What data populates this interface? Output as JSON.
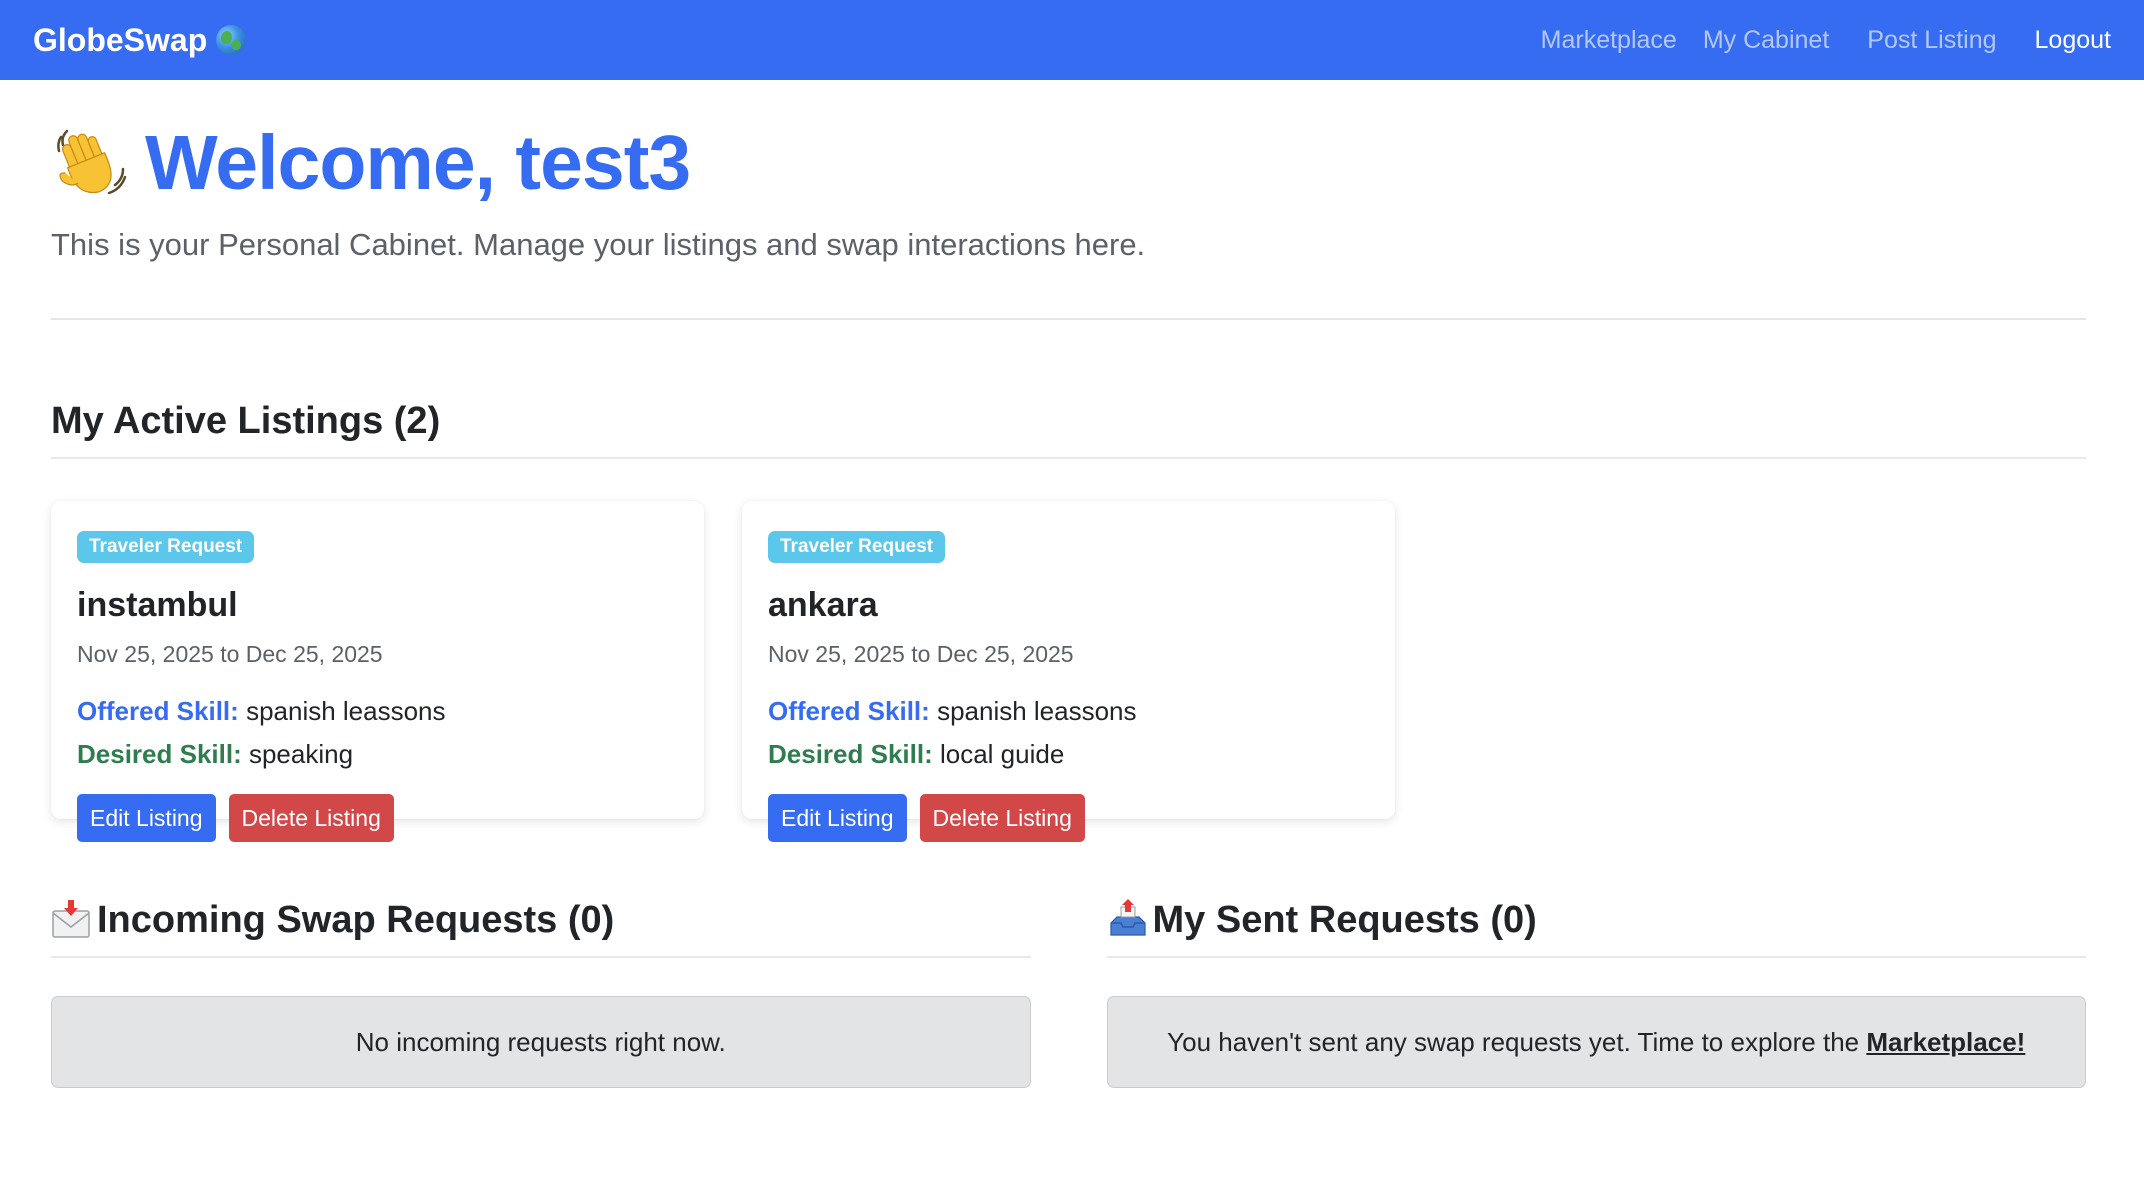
{
  "nav": {
    "brand": "GlobeSwap",
    "brand_icon": "globe-icon",
    "links": [
      "Marketplace",
      "My Cabinet",
      "Post Listing",
      "Logout"
    ],
    "accent": "#356cf2"
  },
  "hero": {
    "icon": "waving-hand-icon",
    "title": "Welcome, test3",
    "subtitle": "This is your Personal Cabinet. Manage your listings and swap interactions here."
  },
  "listings": {
    "title": "My Active Listings (2)",
    "cards": [
      {
        "badge": "Traveler Request",
        "title": "instambul",
        "dates": "Nov 25, 2025 to Dec 25, 2025",
        "offered_label": "Offered Skill:",
        "offered": "spanish leassons",
        "desired_label": "Desired Skill:",
        "desired": "speaking",
        "edit_label": "Edit Listing",
        "delete_label": "Delete Listing"
      },
      {
        "badge": "Traveler Request",
        "title": "ankara",
        "dates": "Nov 25, 2025 to Dec 25, 2025",
        "offered_label": "Offered Skill:",
        "offered": "spanish leassons",
        "desired_label": "Desired Skill:",
        "desired": "local guide",
        "edit_label": "Edit Listing",
        "delete_label": "Delete Listing"
      }
    ]
  },
  "incoming": {
    "icon": "incoming-envelope-icon",
    "title": "Incoming Swap Requests (0)",
    "empty_text": "No incoming requests right now."
  },
  "sent": {
    "icon": "outbox-tray-icon",
    "title": "My Sent Requests (0)",
    "empty_text": "You haven't sent any swap requests yet. Time to explore the ",
    "link_text": "Marketplace!"
  }
}
